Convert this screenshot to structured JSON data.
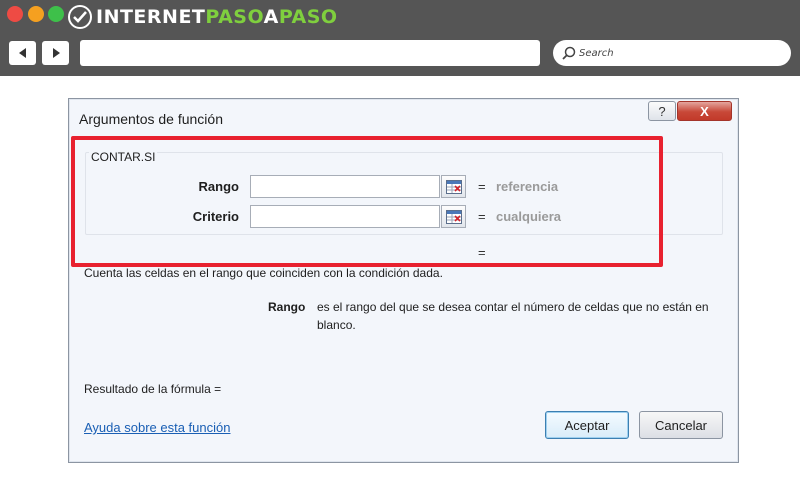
{
  "browser": {
    "logo": {
      "part1": "INTERNET",
      "part2": "PASO",
      "part3": "A",
      "part4": "PASO"
    },
    "search": {
      "placeholder": "Search"
    },
    "colors": {
      "chrome": "#555555",
      "logo_accent": "#7fcf3e"
    }
  },
  "dialog": {
    "title": "Argumentos de función",
    "help_button": "?",
    "close_button": "X",
    "function_name": "CONTAR.SI",
    "arguments": [
      {
        "label": "Rango",
        "value": "",
        "equals": "=",
        "hint": "referencia"
      },
      {
        "label": "Criterio",
        "value": "",
        "equals": "=",
        "hint": "cualquiera"
      }
    ],
    "function_result_equals": "=",
    "description": "Cuenta las celdas en el rango que coinciden con la condición dada.",
    "arg_description": {
      "name": "Rango",
      "text": "es el rango del que se desea contar el número de celdas que no están en blanco."
    },
    "formula_result_label": "Resultado de la fórmula =",
    "help_link": "Ayuda sobre esta función",
    "ok_button": "Aceptar",
    "cancel_button": "Cancelar"
  },
  "annotation": {
    "highlight_color": "#e8212f"
  }
}
